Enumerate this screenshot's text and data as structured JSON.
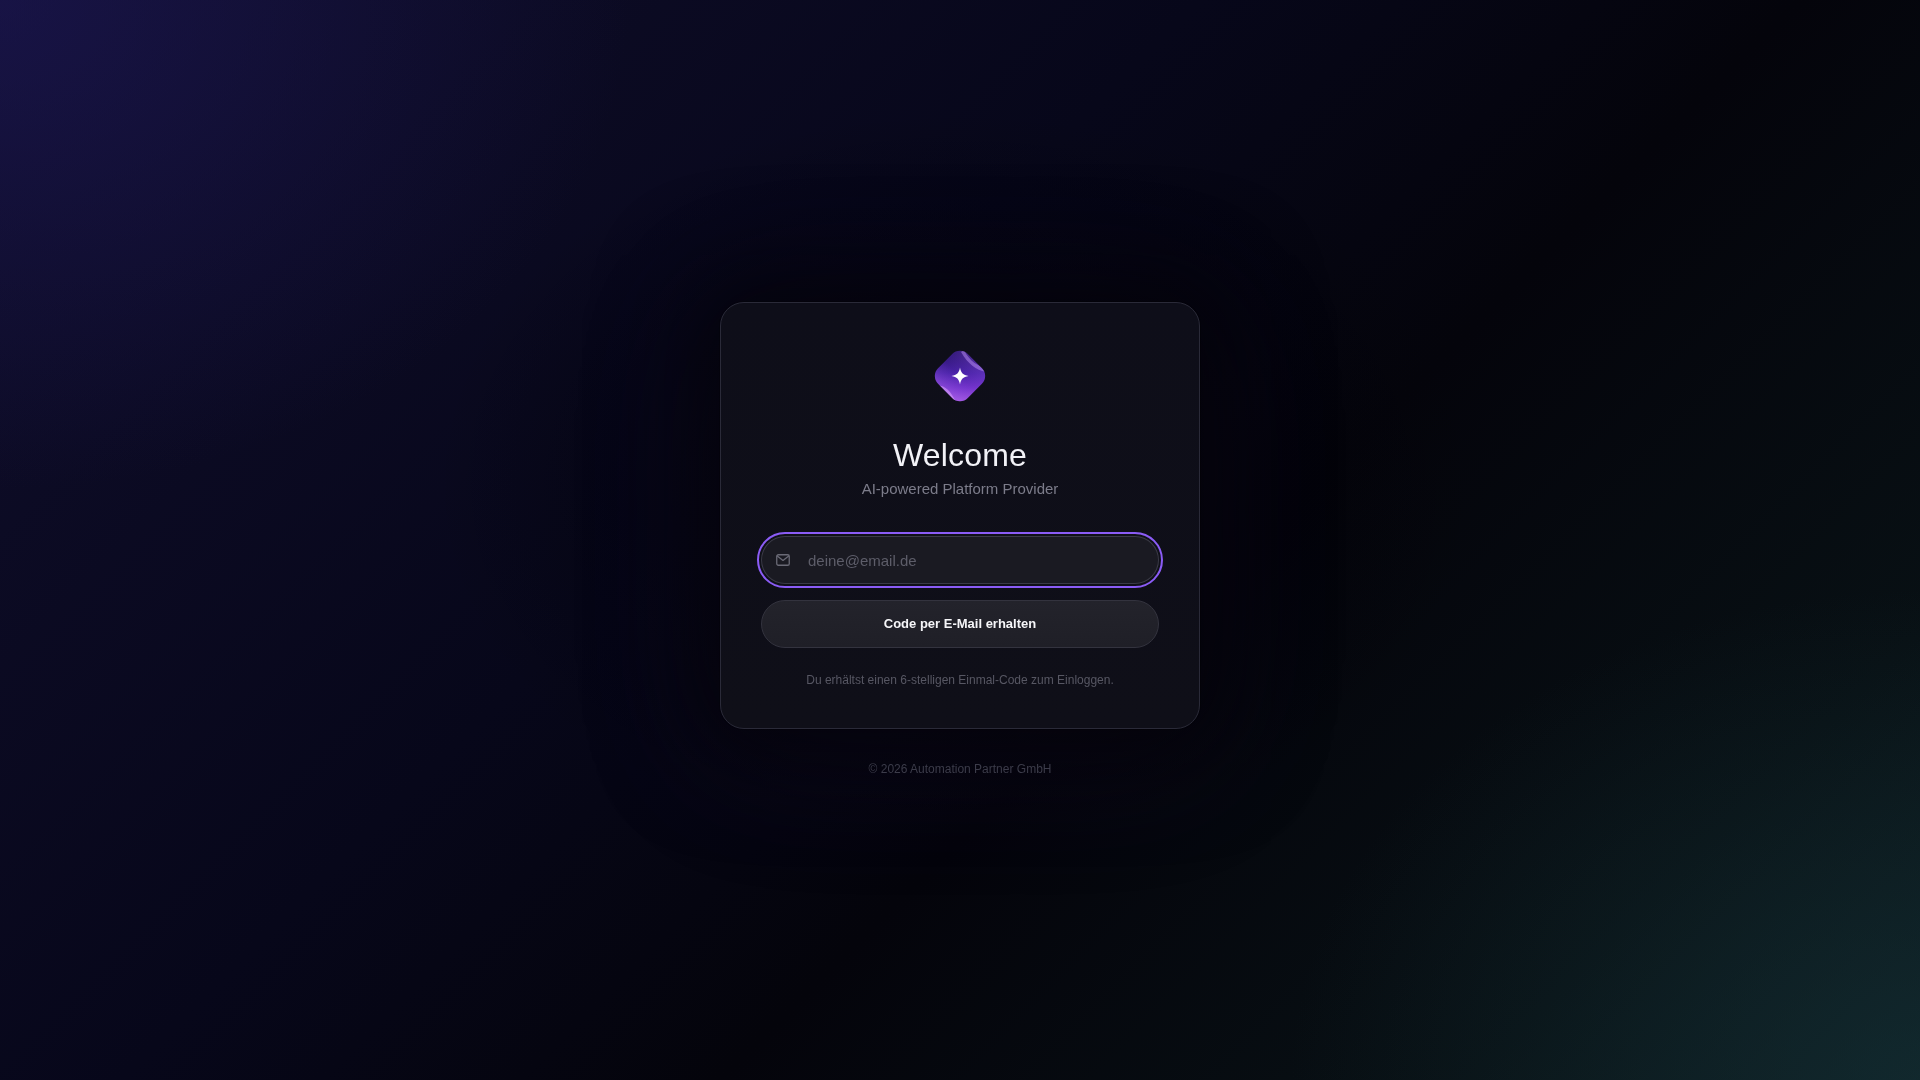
{
  "title": "Welcome",
  "subtitle": "AI-powered Platform Provider",
  "email_field": {
    "placeholder": "deine@email.de",
    "focused": true
  },
  "submit_button": {
    "label": "Code per E-Mail erhalten"
  },
  "hint": "Du erhältst einen 6-stelligen Einmal-Code zum Einloggen.",
  "footer": "© 2026 Automation Partner GmbH"
}
